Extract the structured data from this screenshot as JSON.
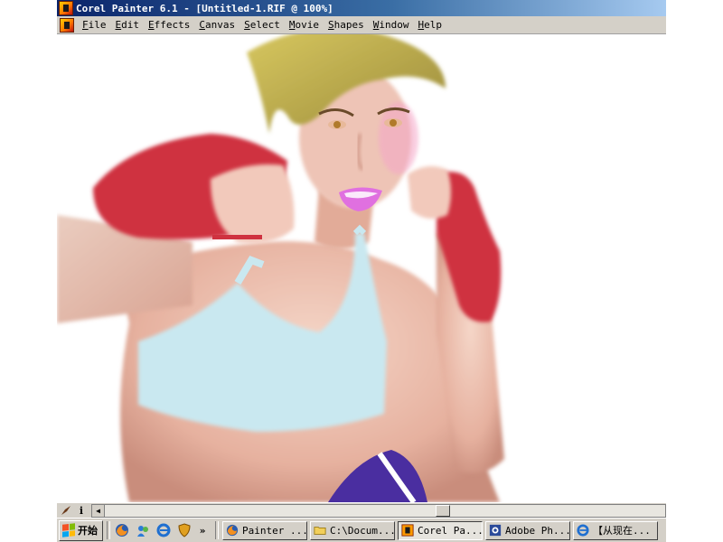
{
  "window": {
    "title": "Corel Painter 6.1 - [Untitled-1.RIF @ 100%]"
  },
  "menu": {
    "items": [
      "File",
      "Edit",
      "Effects",
      "Canvas",
      "Select",
      "Movie",
      "Shapes",
      "Window",
      "Help"
    ]
  },
  "canvas": {
    "content": "painting",
    "zoom_label": "100%"
  },
  "statusbar": {
    "info_glyph": "i",
    "scroll_left_glyph": "◀"
  },
  "taskbar": {
    "start_label": "开始",
    "chevron": "»",
    "tasks": [
      {
        "label": "Painter ...",
        "icon": "firefox-icon"
      },
      {
        "label": "C:\\Docum...",
        "icon": "folder-icon"
      },
      {
        "label": "Corel Pa...",
        "icon": "painter-icon",
        "active": true
      },
      {
        "label": "Adobe Ph...",
        "icon": "photoshop-icon"
      },
      {
        "label": "【从现在...",
        "icon": "ie-icon"
      }
    ]
  },
  "colors": {
    "title_start": "#0a246a",
    "title_end": "#a6caf0",
    "chrome": "#d4d0c8",
    "glove_red": "#cf3240",
    "top_blue": "#c9e8f0",
    "shorts_purple": "#4a2ea0",
    "hair_blond": "#c9b44a",
    "lips_magenta": "#e070e0"
  }
}
